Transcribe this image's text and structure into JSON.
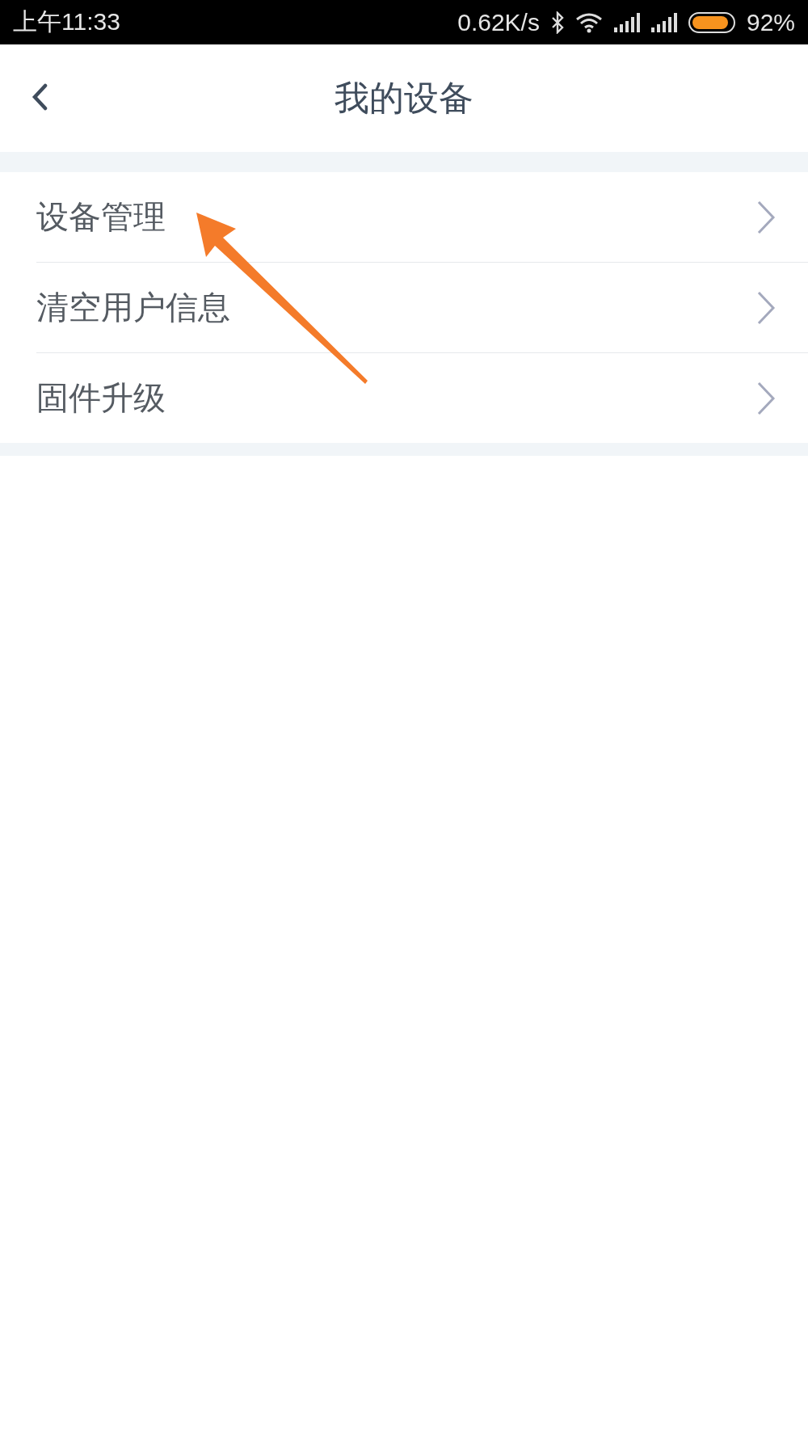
{
  "status_bar": {
    "time": "上午11:33",
    "network_speed": "0.62K/s",
    "battery_percent": "92%"
  },
  "header": {
    "title": "我的设备"
  },
  "menu_items": [
    {
      "label": "设备管理"
    },
    {
      "label": "清空用户信息"
    },
    {
      "label": "固件升级"
    }
  ],
  "annotation": {
    "kind": "arrow"
  }
}
